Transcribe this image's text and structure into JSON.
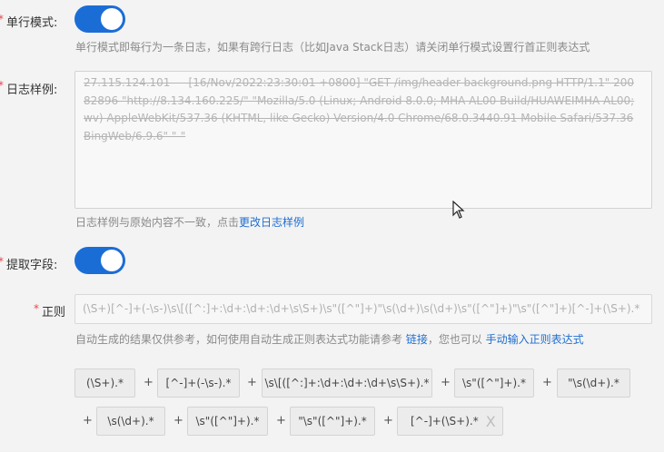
{
  "single_line": {
    "required_mark": "*",
    "label": "单行模式:",
    "hint": "单行模式即每行为一条日志，如果有跨行日志（比如Java Stack日志）请关闭单行模式设置行首正则表达式",
    "enabled": true
  },
  "log_sample": {
    "required_mark": "*",
    "label": "日志样例:",
    "value": "27.115.124.101 - - [16/Nov/2022:23:30:01 +0800] \"GET /img/header-background.png HTTP/1.1\" 200 82896 \"http://8.134.160.225/\" \"Mozilla/5.0 (Linux; Android 8.0.0; MHA-AL00 Build/HUAWEIMHA-AL00; wv) AppleWebKit/537.36 (KHTML, like Gecko) Version/4.0 Chrome/68.0.3440.91 Mobile Safari/537.36 BingWeb/6.9.6\" \"-\"",
    "hint_prefix": "日志样例与原始内容不一致，点击",
    "hint_link": "更改日志样例"
  },
  "extract_fields": {
    "required_mark": "*",
    "label": "提取字段:",
    "enabled": true
  },
  "regex": {
    "required_mark": "*",
    "label": "正则",
    "value": "(\\S+)[^-]+(-\\s-)\\s\\[([^:]+:\\d+:\\d+:\\d+\\s\\S+)\\s\"([^\"]+)\"\\s(\\d+)\\s(\\d+)\\s\"([^\"]+)\"\\s\"([^\"]+)[^-]+(\\S+).*",
    "hint_prefix": "自动生成的结果仅供参考，如何使用自动生成正则表达式功能请参考 ",
    "hint_link1": "链接",
    "hint_middle": "，您也可以 ",
    "hint_link2": "手动输入正则表达式"
  },
  "chips": [
    "(\\S+).*",
    "[^-]+(-\\s-).*",
    "\\s\\[([^:]+:\\d+:\\d+:\\d+\\s\\S+).*",
    "\\s\"([^\"]+).*",
    "\"\\s(\\d+).*",
    "\\s(\\d+).*",
    "\\s\"([^\"]+).*",
    "\"\\s\"([^\"]+).*",
    "[^-]+(\\S+).*"
  ],
  "plus_sign": "+",
  "remove_symbol": "X"
}
